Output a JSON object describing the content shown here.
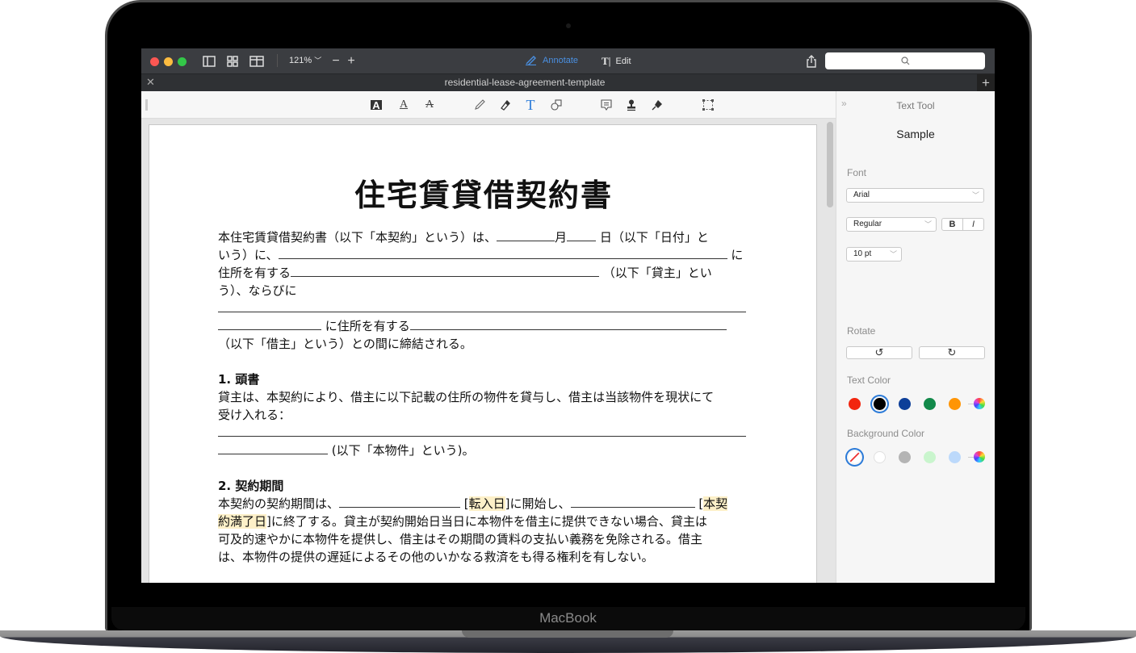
{
  "device": {
    "brand": "MacBook"
  },
  "window": {
    "zoom_level": "121%",
    "modes": [
      {
        "label": "Annotate",
        "active": true
      },
      {
        "label": "Edit",
        "active": false
      }
    ],
    "search_placeholder": "",
    "tab_title": "residential-lease-agreement-template",
    "traffic_lights": {
      "close": "#fc5753",
      "minimize": "#fdbc40",
      "maximize": "#33c748"
    }
  },
  "toolbar": {
    "tools": [
      "text-highlight-icon",
      "underline-icon",
      "strikethrough-icon",
      "pencil-icon",
      "eraser-icon",
      "text-tool-icon",
      "shapes-icon",
      "note-icon",
      "stamp-icon",
      "signature-icon",
      "selection-icon"
    ],
    "active_tool": "text-tool-icon",
    "accent": "#2a7ad8"
  },
  "document": {
    "title": "住宅賃貸借契約書",
    "intro": [
      {
        "parts": [
          "本住宅賃貸借契約書（以下「本契約」という）は、",
          "月",
          "日（以下「日付」と"
        ]
      },
      {
        "parts": [
          "いう）に、",
          "に"
        ]
      },
      {
        "parts": [
          "住所を有する",
          "（以下「貸主」とい"
        ]
      },
      {
        "parts": [
          "う）、ならびに"
        ]
      },
      {
        "parts": [
          "に住所を有する"
        ]
      },
      {
        "parts": [
          "（以下「借主」という）との間に締結される。"
        ]
      }
    ],
    "sections": [
      {
        "heading": "1. 頭書",
        "lines": [
          "貸主は、本契約により、借主に以下記載の住所の物件を貸与し、借主は当該物件を現状にて",
          "受け入れる：",
          "(以下「本物件」という)。"
        ]
      },
      {
        "heading": "2. 契約期間",
        "lines": [
          "本契約の契約期間は、",
          "[",
          "転入日",
          "]に開始し、",
          "[",
          "本契",
          "約満了日",
          "]に終了する。貸主が契約開始日当日に本物件を借主に提供できない場合、貸主は",
          "可及的速やかに本物件を提供し、借主はその期間の賃料の支払い義務を免除される。借主",
          "は、本物件の提供の遅延によるその他のいかなる救済をも得る権利を有しない。"
        ]
      }
    ]
  },
  "panel": {
    "title": "Text Tool",
    "sample": "Sample",
    "font_label": "Font",
    "font_value": "Arial",
    "style_value": "Regular",
    "bold_label": "B",
    "italic_label": "I",
    "size_value": "10 pt",
    "rotate_label": "Rotate",
    "text_color_label": "Text Color",
    "text_colors": [
      "#f2260f",
      "#000000",
      "#0d3f99",
      "#12894a",
      "#ff9505"
    ],
    "text_color_selected": 1,
    "background_color_label": "Background Color",
    "background_colors": [
      "none",
      "#ffffff",
      "#b4b4b4",
      "#c9f5cd",
      "#bcd9fb"
    ],
    "background_color_selected": 0
  }
}
